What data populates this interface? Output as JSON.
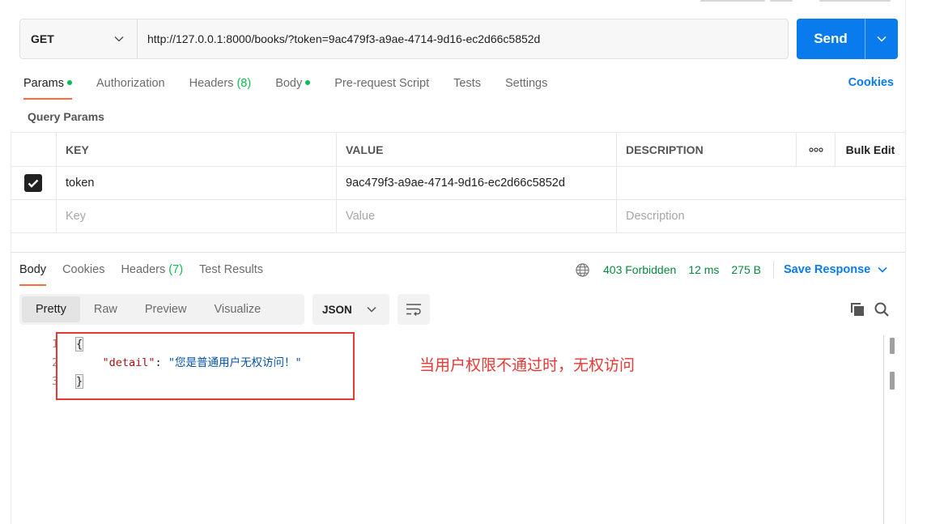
{
  "request": {
    "method": "GET",
    "url": "http://127.0.0.1:8000/books/?token=9ac479f3-a9ae-4714-9d16-ec2d66c5852d",
    "send_label": "Send"
  },
  "tabs": [
    {
      "label": "Params"
    },
    {
      "label": "Authorization"
    },
    {
      "label": "Headers",
      "count": "(8)"
    },
    {
      "label": "Body"
    },
    {
      "label": "Pre-request Script"
    },
    {
      "label": "Tests"
    },
    {
      "label": "Settings"
    }
  ],
  "cookies_label": "Cookies",
  "query_params": {
    "title": "Query Params",
    "headers": [
      "KEY",
      "VALUE",
      "DESCRIPTION"
    ],
    "bulk_edit_label": "Bulk Edit",
    "rows": [
      {
        "key": "token",
        "value": "9ac479f3-a9ae-4714-9d16-ec2d66c5852d",
        "description": ""
      }
    ],
    "placeholders": {
      "key": "Key",
      "value": "Value",
      "description": "Description"
    }
  },
  "response": {
    "tabs": [
      {
        "label": "Body"
      },
      {
        "label": "Cookies"
      },
      {
        "label": "Headers",
        "count": "(7)"
      },
      {
        "label": "Test Results"
      }
    ],
    "status": "403 Forbidden",
    "time": "12 ms",
    "size": "275 B",
    "save_label": "Save Response",
    "views": [
      "Pretty",
      "Raw",
      "Preview",
      "Visualize"
    ],
    "format": "JSON",
    "line_numbers": [
      "1",
      "2",
      "3"
    ],
    "code": {
      "open": "{",
      "key": "\"detail\"",
      "colon": ": ",
      "value": "\"您是普通用户无权访问！\"",
      "close": "}"
    }
  },
  "annotation": "当用户权限不通过时，无权访问",
  "colors": {
    "accent": "#097bed",
    "active_tab": "#ff6c37",
    "status_ok": "#0cbb52",
    "highlight": "#e53935"
  }
}
